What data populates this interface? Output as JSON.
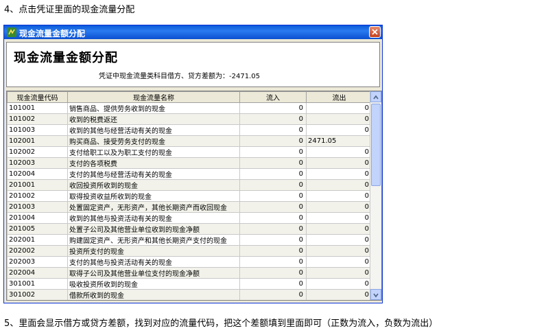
{
  "instructions": {
    "step4": "4、点击凭证里面的现金流量分配",
    "step5": "5、里面会显示借方或贷方差额，找到对应的流量代码，把这个差额填到里面即可（正数为流入，负数为流出）"
  },
  "window": {
    "title": "现金流量金额分配",
    "heading": "现金流量金额分配",
    "subtitle": "凭证中现金流量类科目借方、贷方差额为：-2471.05"
  },
  "table": {
    "columns": [
      "现金流量代码",
      "现金流量名称",
      "流入",
      "流出"
    ],
    "rows": [
      {
        "code": "101001",
        "name": "销售商品、提供劳务收到的现金",
        "in": "0",
        "out": "0"
      },
      {
        "code": "101002",
        "name": "收到的税费返还",
        "in": "0",
        "out": "0"
      },
      {
        "code": "101003",
        "name": "收到的其他与经营活动有关的现金",
        "in": "0",
        "out": "0"
      },
      {
        "code": "102001",
        "name": "购买商品、接受劳务支付的现金",
        "in": "0",
        "out": "2471.05"
      },
      {
        "code": "102002",
        "name": "支付给职工以及为职工支付的现金",
        "in": "0",
        "out": "0"
      },
      {
        "code": "102003",
        "name": "支付的各项税费",
        "in": "0",
        "out": "0"
      },
      {
        "code": "102004",
        "name": "支付的其他与经营活动有关的现金",
        "in": "0",
        "out": "0"
      },
      {
        "code": "201001",
        "name": "收回投资所收到的现金",
        "in": "0",
        "out": "0"
      },
      {
        "code": "201002",
        "name": "取得投资收益所收到的现金",
        "in": "0",
        "out": "0"
      },
      {
        "code": "201003",
        "name": "处置固定资产，无形资产，其他长期资产而收回现金",
        "in": "0",
        "out": "0"
      },
      {
        "code": "201004",
        "name": "收到的其他与投资活动有关的现金",
        "in": "0",
        "out": "0"
      },
      {
        "code": "201005",
        "name": "处置子公司及其他营业单位收到的现金净额",
        "in": "0",
        "out": "0"
      },
      {
        "code": "202001",
        "name": "购建固定资产、无形资产和其他长期资产支付的现金",
        "in": "0",
        "out": "0"
      },
      {
        "code": "202002",
        "name": "投资所支付的现金",
        "in": "0",
        "out": "0"
      },
      {
        "code": "202003",
        "name": "支付的其他与投资活动有关的现金",
        "in": "0",
        "out": "0"
      },
      {
        "code": "202004",
        "name": "取得子公司及其他营业单位支付的现金净额",
        "in": "0",
        "out": "0"
      },
      {
        "code": "301001",
        "name": "吸收投资所收到的现金",
        "in": "0",
        "out": "0"
      },
      {
        "code": "301002",
        "name": "借款所收到的现金",
        "in": "0",
        "out": "0"
      }
    ]
  },
  "icons": {
    "app": "app-icon",
    "close": "close-icon",
    "scroll_up": "chevron-up-icon",
    "scroll_down": "chevron-down-icon"
  },
  "colors": {
    "titlebar": "#0a5bd8",
    "close": "#c4401b",
    "window_bg": "#ece9d8"
  }
}
